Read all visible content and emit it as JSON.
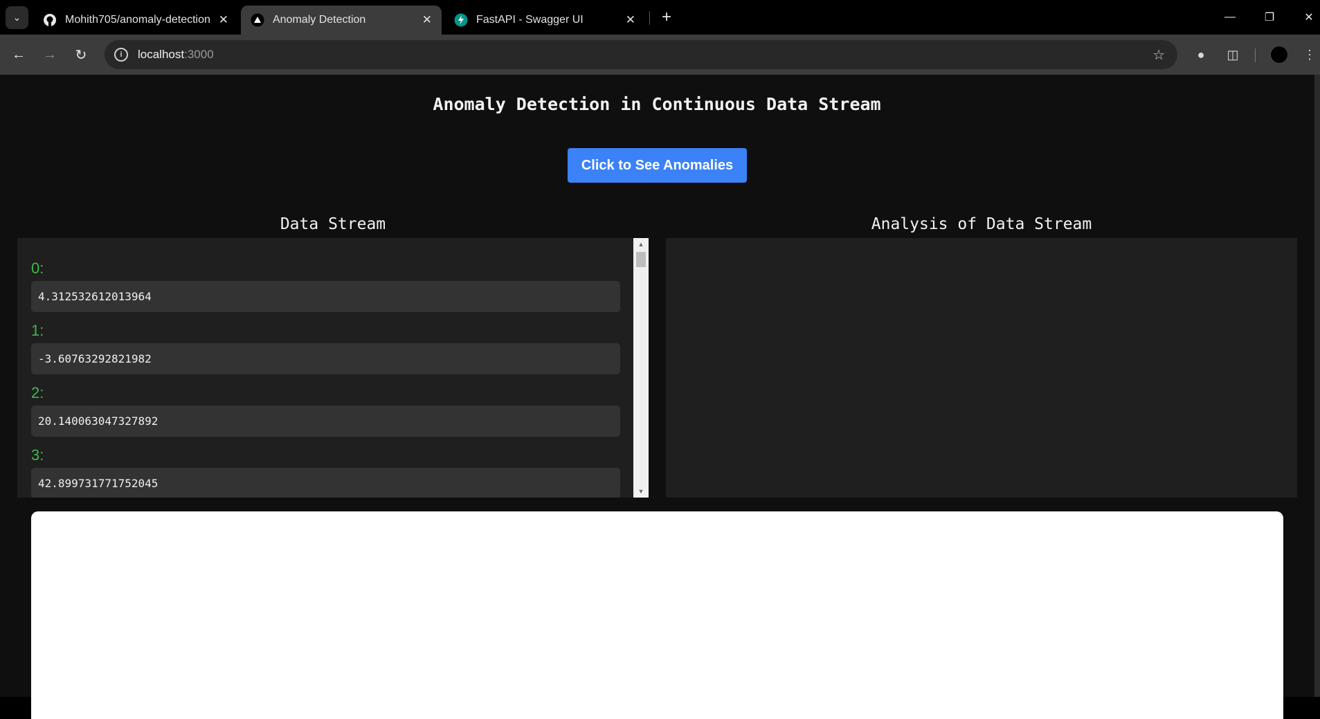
{
  "browser": {
    "tabs": [
      {
        "title": "Mohith705/anomaly-detection",
        "icon": "github-icon"
      },
      {
        "title": "Anomaly Detection",
        "icon": "vercel-triangle-icon"
      },
      {
        "title": "FastAPI - Swagger UI",
        "icon": "fastapi-icon"
      }
    ],
    "active_tab": 1,
    "url_host": "localhost",
    "url_port": ":3000"
  },
  "page": {
    "title": "Anomaly Detection in Continuous Data Stream",
    "cta_label": "Click to See Anomalies",
    "stream_heading": "Data Stream",
    "analysis_heading": "Analysis of Data Stream",
    "stream": [
      {
        "index": "0:",
        "value": "4.312532612013964"
      },
      {
        "index": "1:",
        "value": "-3.60763292821982"
      },
      {
        "index": "2:",
        "value": "20.140063047327892"
      },
      {
        "index": "3:",
        "value": "42.899731771752045"
      }
    ]
  },
  "colors": {
    "accent": "#3b82f6",
    "index_green": "#3fb94c",
    "panel": "#1f1f1f"
  }
}
